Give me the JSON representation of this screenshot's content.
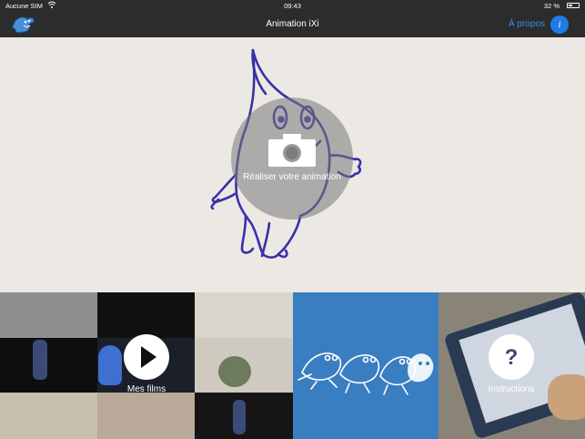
{
  "status_bar": {
    "carrier": "Aucune SIM",
    "time": "09:43",
    "battery": "32 %"
  },
  "nav": {
    "title": "Animation iXi",
    "about_label": "À propos",
    "info_icon": "info-icon"
  },
  "hero": {
    "create_label": "Réaliser votre animation",
    "icon": "camera-icon"
  },
  "tiles": [
    {
      "label": "Mes films",
      "icon": "play-icon"
    },
    {
      "label": "",
      "icon": "characters-logo"
    },
    {
      "label": "Instructions",
      "icon": "question-icon"
    }
  ],
  "colors": {
    "nav_bg": "#2c2c2c",
    "accent": "#1e7be8",
    "tile_blue": "#3a7ec2",
    "ink": "#3b2fa8"
  }
}
